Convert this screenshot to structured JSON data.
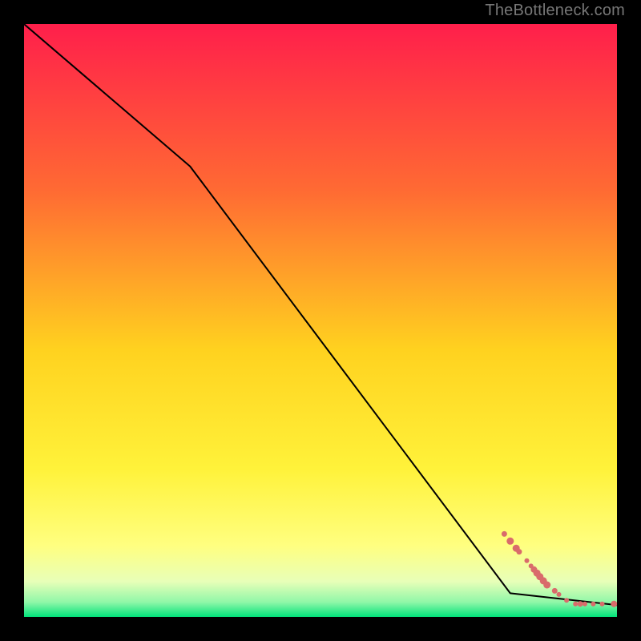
{
  "watermark": "TheBottleneck.com",
  "colors": {
    "background": "#000000",
    "gradient_top": "#ff1f4b",
    "gradient_mid_upper": "#ff7a2d",
    "gradient_mid": "#ffd21f",
    "gradient_mid_lower": "#ffff5a",
    "gradient_lower": "#f6ffb0",
    "gradient_bottom": "#00e37a",
    "line": "#000000",
    "marker": "#d96b6b"
  },
  "chart_data": {
    "type": "line",
    "title": "",
    "xlabel": "",
    "ylabel": "",
    "xlim": [
      0,
      100
    ],
    "ylim": [
      0,
      100
    ],
    "series": [
      {
        "name": "curve",
        "x": [
          0,
          28,
          82,
          100
        ],
        "values": [
          100,
          76,
          4,
          2
        ],
        "style": "line"
      },
      {
        "name": "markers",
        "x": [
          81,
          82,
          83,
          83.5,
          84.8,
          85.5,
          86,
          86.5,
          87,
          87.6,
          88.2,
          89.5,
          90.2,
          91.5,
          93,
          93.8,
          94.6,
          96,
          97.5,
          99.5
        ],
        "values": [
          14,
          12.8,
          11.6,
          11,
          9.5,
          8.6,
          8,
          7.4,
          6.8,
          6.1,
          5.4,
          4.4,
          3.8,
          2.8,
          2.2,
          2.2,
          2.2,
          2.2,
          2.2,
          2.2
        ],
        "sizes": [
          3.5,
          4.5,
          4.5,
          3.5,
          3,
          3,
          4,
          4.5,
          4.5,
          4.5,
          4.5,
          3.5,
          3,
          3,
          3,
          3.5,
          3,
          3,
          3,
          4
        ],
        "style": "scatter"
      }
    ]
  }
}
